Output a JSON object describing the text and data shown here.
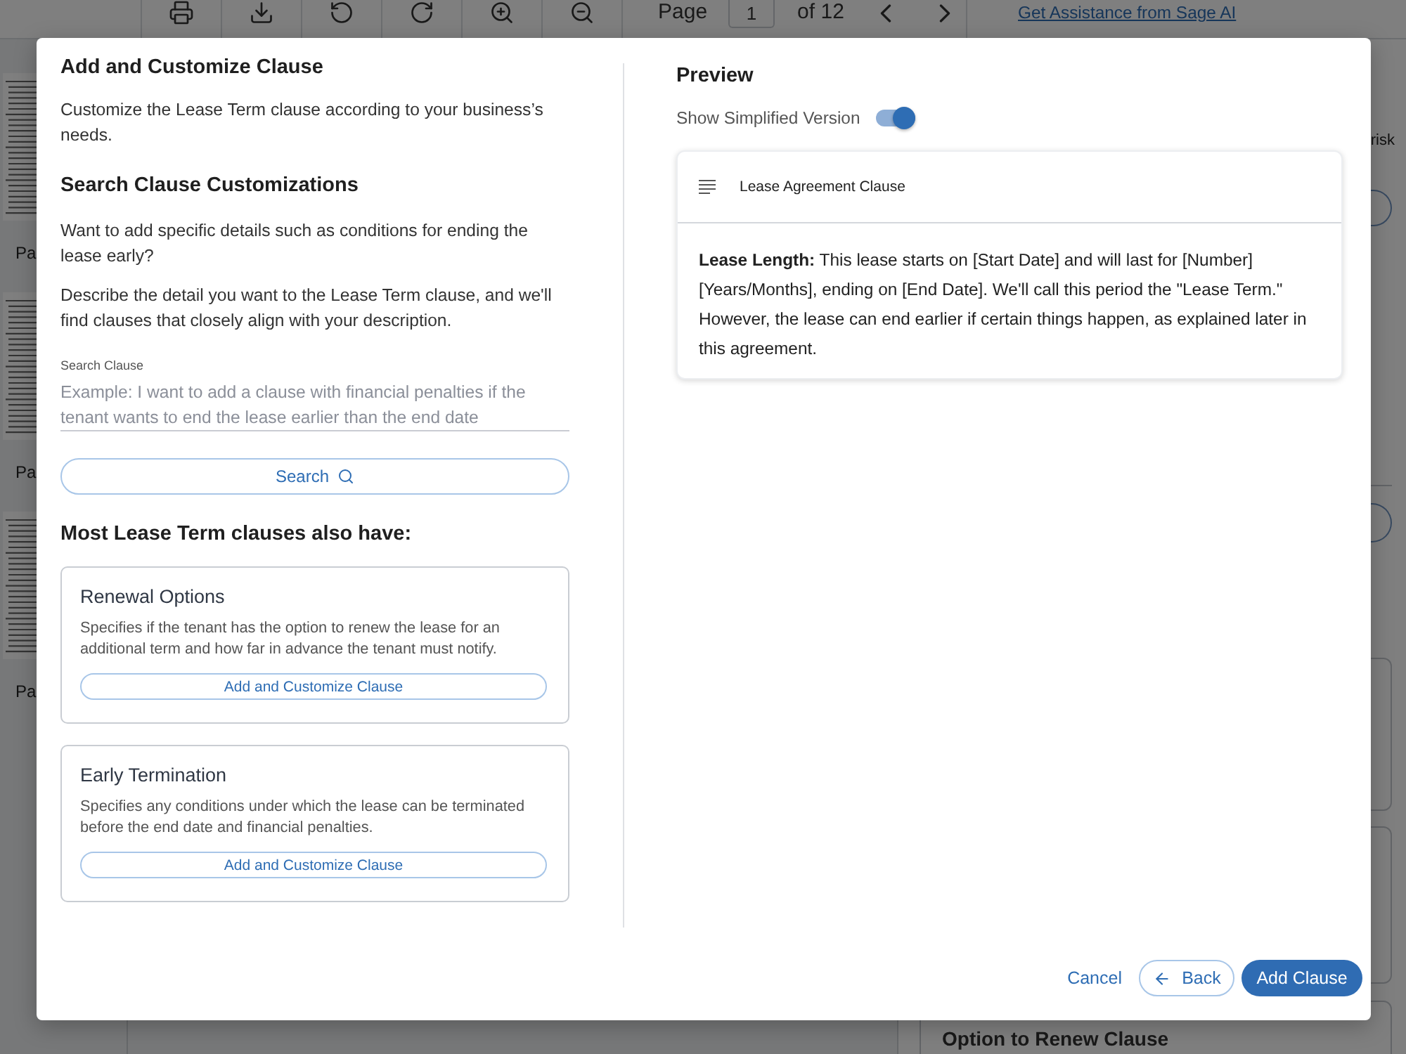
{
  "toolbar": {
    "page_label": "Page",
    "page_number": "1",
    "page_count": "of 12",
    "assist_link": "Get Assistance from Sage AI"
  },
  "thumbnails": [
    {
      "label": "Pa"
    },
    {
      "label": "Pa"
    },
    {
      "label": "Pa"
    }
  ],
  "side_panel": {
    "text": "risk",
    "clause_title": "Option to Renew Clause"
  },
  "dialog": {
    "title": "Add and Customize Clause",
    "intro": "Customize the Lease Term clause according to your business’s needs.",
    "search_heading": "Search Clause Customizations",
    "search_prompts": [
      "Want to add specific details such as conditions for ending the lease early?",
      "Describe the detail you want to the Lease Term clause, and we'll find clauses that closely align with your description."
    ],
    "search_field": {
      "label": "Search Clause",
      "placeholder": "Example: I want to add a clause with financial penalties if the tenant wants to end the lease earlier than the end date"
    },
    "search_button": "Search",
    "suggestions_heading": "Most Lease Term clauses also have:",
    "suggestions": [
      {
        "title": "Renewal Options",
        "description": "Specifies if the tenant has the option to renew the lease for an additional term and how far in advance the tenant must notify.",
        "button": "Add and Customize Clause"
      },
      {
        "title": "Early Termination",
        "description": "Specifies any conditions under which the lease can be terminated before the end date and financial penalties.",
        "button": "Add and Customize Clause"
      }
    ],
    "preview": {
      "heading": "Preview",
      "toggle": {
        "label": "Show Simplified Version",
        "on": true
      },
      "card": {
        "title": "Lease Agreement Clause",
        "text": "**Lease Length:** This lease starts on [Start Date] and will last for [Number] [Years/Months], ending on [End Date]. We'll call this period the \"Lease Term.\" However, the lease can end earlier if certain things happen, as explained later in this agreement."
      }
    },
    "footer": {
      "cancel": "Cancel",
      "back": "Back",
      "confirm": "Add Clause"
    }
  }
}
